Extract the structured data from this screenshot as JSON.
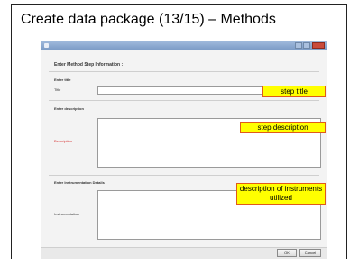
{
  "slide": {
    "title": "Create data package (13/15) – Methods"
  },
  "dialog": {
    "heading": "Enter Method Step Information :",
    "sections": {
      "title_section": "Enter title",
      "description_section": "Enter description",
      "instrumentation_section": "Enter Instrumentation Details"
    },
    "labels": {
      "title": "Title",
      "description": "Description",
      "instrumentation": "Instrumentation"
    },
    "buttons": {
      "ok": "OK",
      "cancel": "Cancel"
    }
  },
  "callouts": {
    "title": "step title",
    "description": "step description",
    "instruments": "description of instruments utilized"
  },
  "colors": {
    "callout_fill": "#ffff00",
    "callout_border": "#e05a1a",
    "required_label": "#d32020",
    "titlebar": "#7d9cc7"
  }
}
